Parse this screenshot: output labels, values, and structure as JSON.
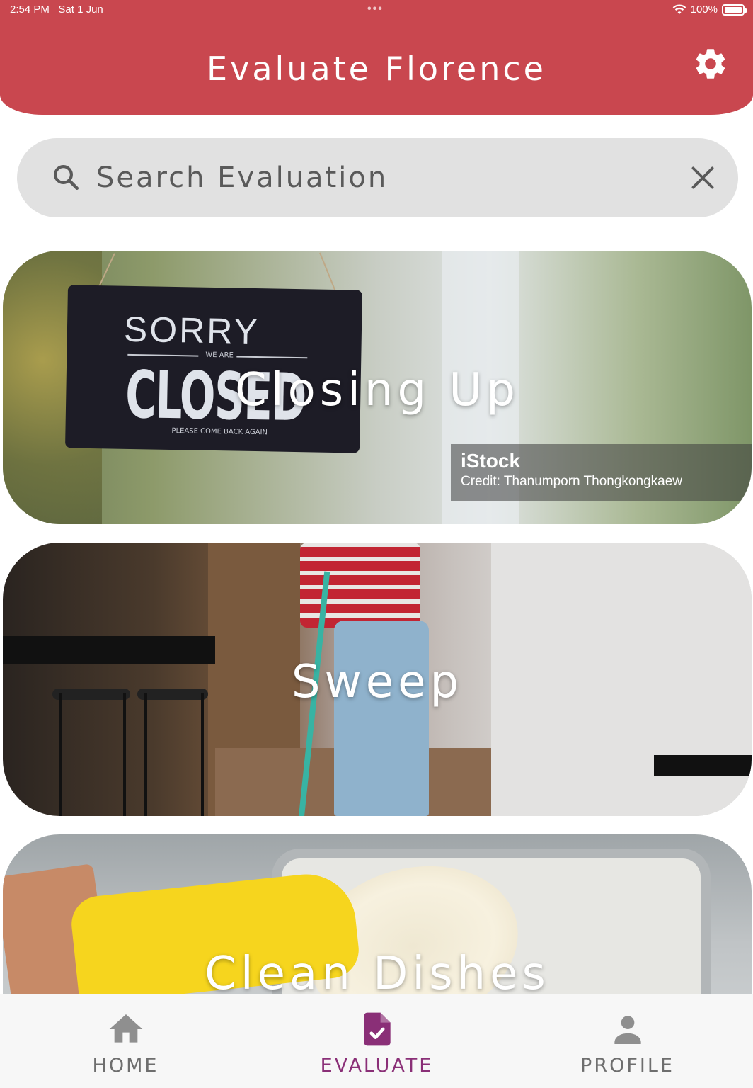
{
  "status_bar": {
    "time": "2:54 PM",
    "date": "Sat 1 Jun",
    "battery": "100%"
  },
  "header": {
    "title": "Evaluate Florence",
    "settings_icon": "gear-icon"
  },
  "search": {
    "placeholder": "Search Evaluation",
    "value": ""
  },
  "cards": [
    {
      "label": "Closing Up",
      "sign": {
        "sorry": "SORRY",
        "we_are": "WE ARE",
        "closed": "CLOSED",
        "come_back": "PLEASE COME BACK AGAIN"
      },
      "watermark": {
        "brand": "iStock",
        "credit": "Credit: Thanumporn Thongkongkaew"
      }
    },
    {
      "label": "Sweep"
    },
    {
      "label": "Clean Dishes"
    }
  ],
  "bottom_nav": {
    "items": [
      {
        "label": "HOME",
        "icon": "home-icon"
      },
      {
        "label": "EVALUATE",
        "icon": "evaluate-document-icon"
      },
      {
        "label": "PROFILE",
        "icon": "person-icon"
      }
    ],
    "active": "EVALUATE"
  },
  "colors": {
    "header": "#c9474f",
    "active_nav": "#8a2f77",
    "inactive_nav": "#6e6e6e"
  }
}
